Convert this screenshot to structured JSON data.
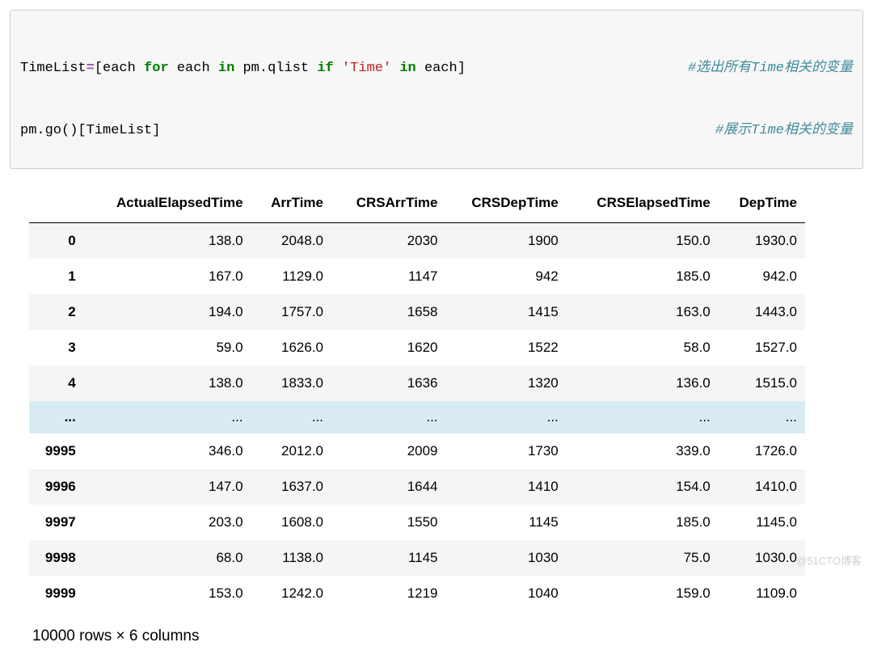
{
  "code": {
    "line1_left": {
      "a": "TimeList",
      "b": "=",
      "c": "[each ",
      "d": "for",
      "e": " each ",
      "f": "in",
      "g": " pm.qlist ",
      "h": "if",
      "i": " ",
      "j": "'Time'",
      "k": " ",
      "l": "in",
      "m": " each]"
    },
    "line1_comment": "#选出所有Time相关的变量",
    "line2_left": "pm.go()[TimeList]",
    "line2_comment": "#展示Time相关的变量"
  },
  "dataframe": {
    "columns": [
      "ActualElapsedTime",
      "ArrTime",
      "CRSArrTime",
      "CRSDepTime",
      "CRSElapsedTime",
      "DepTime"
    ],
    "rows": [
      {
        "idx": "0",
        "vals": [
          "138.0",
          "2048.0",
          "2030",
          "1900",
          "150.0",
          "1930.0"
        ]
      },
      {
        "idx": "1",
        "vals": [
          "167.0",
          "1129.0",
          "1147",
          "942",
          "185.0",
          "942.0"
        ]
      },
      {
        "idx": "2",
        "vals": [
          "194.0",
          "1757.0",
          "1658",
          "1415",
          "163.0",
          "1443.0"
        ]
      },
      {
        "idx": "3",
        "vals": [
          "59.0",
          "1626.0",
          "1620",
          "1522",
          "58.0",
          "1527.0"
        ]
      },
      {
        "idx": "4",
        "vals": [
          "138.0",
          "1833.0",
          "1636",
          "1320",
          "136.0",
          "1515.0"
        ]
      },
      {
        "idx": "...",
        "vals": [
          "...",
          "...",
          "...",
          "...",
          "...",
          "..."
        ],
        "ellipsis": true
      },
      {
        "idx": "9995",
        "vals": [
          "346.0",
          "2012.0",
          "2009",
          "1730",
          "339.0",
          "1726.0"
        ]
      },
      {
        "idx": "9996",
        "vals": [
          "147.0",
          "1637.0",
          "1644",
          "1410",
          "154.0",
          "1410.0"
        ]
      },
      {
        "idx": "9997",
        "vals": [
          "203.0",
          "1608.0",
          "1550",
          "1145",
          "185.0",
          "1145.0"
        ]
      },
      {
        "idx": "9998",
        "vals": [
          "68.0",
          "1138.0",
          "1145",
          "1030",
          "75.0",
          "1030.0"
        ]
      },
      {
        "idx": "9999",
        "vals": [
          "153.0",
          "1242.0",
          "1219",
          "1040",
          "159.0",
          "1109.0"
        ]
      }
    ],
    "summary": "10000 rows × 6 columns"
  },
  "watermark": "@51CTO博客"
}
